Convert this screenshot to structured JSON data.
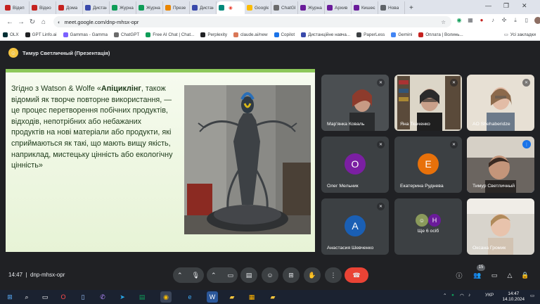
{
  "tabs": [
    {
      "label": "Відеп",
      "color": "#c5221f"
    },
    {
      "label": "Відео",
      "color": "#c5221f"
    },
    {
      "label": "Дома",
      "color": "#c5221f"
    },
    {
      "label": "Дистан",
      "color": "#3949ab"
    },
    {
      "label": "Журна",
      "color": "#0f9d58"
    },
    {
      "label": "Журна",
      "color": "#0f9d58"
    },
    {
      "label": "Презе",
      "color": "#ea8600"
    },
    {
      "label": "Дистан",
      "color": "#3949ab"
    },
    {
      "label": "",
      "color": "#00897b"
    },
    {
      "label": "Google",
      "color": "#fbbc04"
    },
    {
      "label": "ChatGP",
      "color": "#6b6b6b"
    },
    {
      "label": "Журна",
      "color": "#6a1b9a"
    },
    {
      "label": "Архив",
      "color": "#6a1b9a"
    },
    {
      "label": "Кишеє",
      "color": "#6a1b9a"
    },
    {
      "label": "Нова",
      "color": "#5f6368"
    }
  ],
  "window": {
    "minimize": "—",
    "maximize": "❐",
    "close": "✕",
    "new_tab": "+"
  },
  "address": {
    "url": "meet.google.com/dnp-mhsx-opr"
  },
  "bookmarks": [
    {
      "label": "OLX",
      "color": "#002f34"
    },
    {
      "label": "GPT Linfo.ai",
      "color": "#202124"
    },
    {
      "label": "Gammas - Gamma",
      "color": "#7b61ff"
    },
    {
      "label": "ChatGPT",
      "color": "#6b6b6b"
    },
    {
      "label": "Free AI Chat | Chat...",
      "color": "#0f9d58"
    },
    {
      "label": "Perplexity",
      "color": "#202124"
    },
    {
      "label": "claude.ai/new",
      "color": "#d97757"
    },
    {
      "label": "Copilot",
      "color": "#1a73e8"
    },
    {
      "label": "Дистанційне навча...",
      "color": "#3949ab"
    },
    {
      "label": "PaperLess",
      "color": "#3c4043"
    },
    {
      "label": "Gemini",
      "color": "#4285f4"
    },
    {
      "label": "Оплата | Волинь...",
      "color": "#c5221f"
    }
  ],
  "bookmarks_all": "Усі закладки",
  "presenter": {
    "label": "Тимур Светличный (Презентація)"
  },
  "slide": {
    "intro": "Згідно з Watson & Wolfe «",
    "term": "Апіциклінг",
    "rest": ", також відомий як творче повторне використання, — це процес перетворення побічних продуктів, відходів, непотрібних або небажаних продуктів на нові матеріали або продукти, які сприймаються як такі, що мають вищу якість, наприклад, мистецьку цінність або екологічну цінність»"
  },
  "participants": [
    {
      "name": "Мар'янка Коваль",
      "type": "photo",
      "muted": true
    },
    {
      "name": "Яна Ткаченко",
      "type": "photo",
      "muted": true
    },
    {
      "name": "AO Shehaberidze",
      "type": "photo",
      "muted": true
    },
    {
      "name": "Олег Мельник",
      "type": "avatar",
      "initial": "О",
      "color": "#7b1fa2",
      "muted": true
    },
    {
      "name": "Екатерина Руднева",
      "type": "avatar",
      "initial": "Е",
      "color": "#e8710a",
      "muted": true
    },
    {
      "name": "Тимур Светличный",
      "type": "photo",
      "speaking": true
    },
    {
      "name": "Анастасия Шевченко",
      "type": "avatar",
      "initial": "А",
      "color": "#1a5fb4",
      "muted": true
    },
    {
      "name": "Ще 6 осіб",
      "type": "more",
      "initial": "Н",
      "color": "#6a1b9a"
    },
    {
      "name": "Оксана Громик",
      "type": "photo"
    }
  ],
  "meeting": {
    "time": "14:47",
    "code": "dnp-mhsx-opr",
    "participants_count": "15"
  },
  "taskbar": {
    "lang": "УКР",
    "time": "14:47",
    "date": "14.10.2024"
  }
}
